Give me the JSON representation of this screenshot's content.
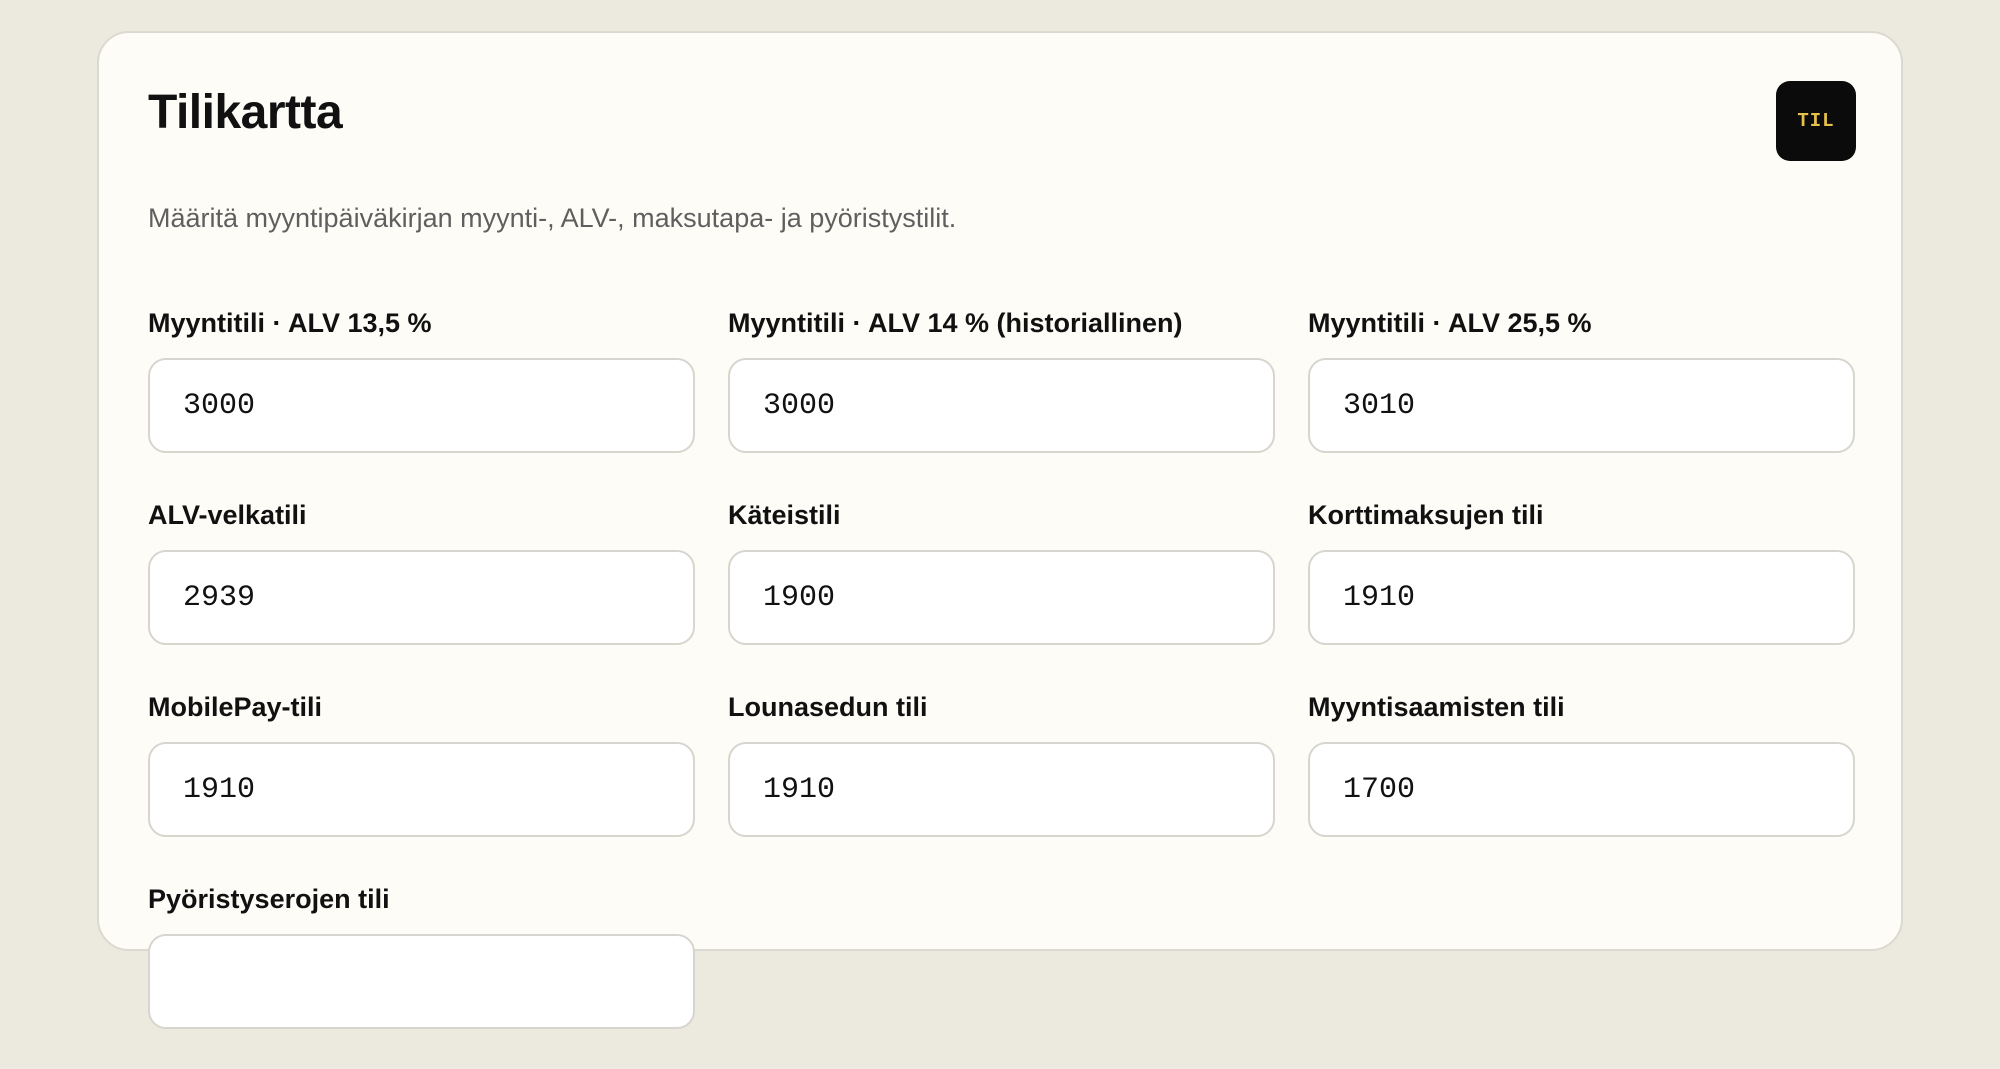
{
  "card": {
    "title": "Tilikartta",
    "badge": "TIL",
    "description": "Määritä myyntipäiväkirjan myynti-, ALV-, maksutapa- ja pyöristystilit."
  },
  "fields": [
    {
      "label": "Myyntitili · ALV 13,5 %",
      "value": "3000"
    },
    {
      "label": "Myyntitili · ALV 14 % (historiallinen)",
      "value": "3000"
    },
    {
      "label": "Myyntitili · ALV 25,5 %",
      "value": "3010"
    },
    {
      "label": "ALV-velkatili",
      "value": "2939"
    },
    {
      "label": "Käteistili",
      "value": "1900"
    },
    {
      "label": "Korttimaksujen tili",
      "value": "1910"
    },
    {
      "label": "MobilePay-tili",
      "value": "1910"
    },
    {
      "label": "Lounasedun tili",
      "value": "1910"
    },
    {
      "label": "Myyntisaamisten tili",
      "value": "1700"
    },
    {
      "label": "Pyöristyserojen tili",
      "value": ""
    }
  ]
}
